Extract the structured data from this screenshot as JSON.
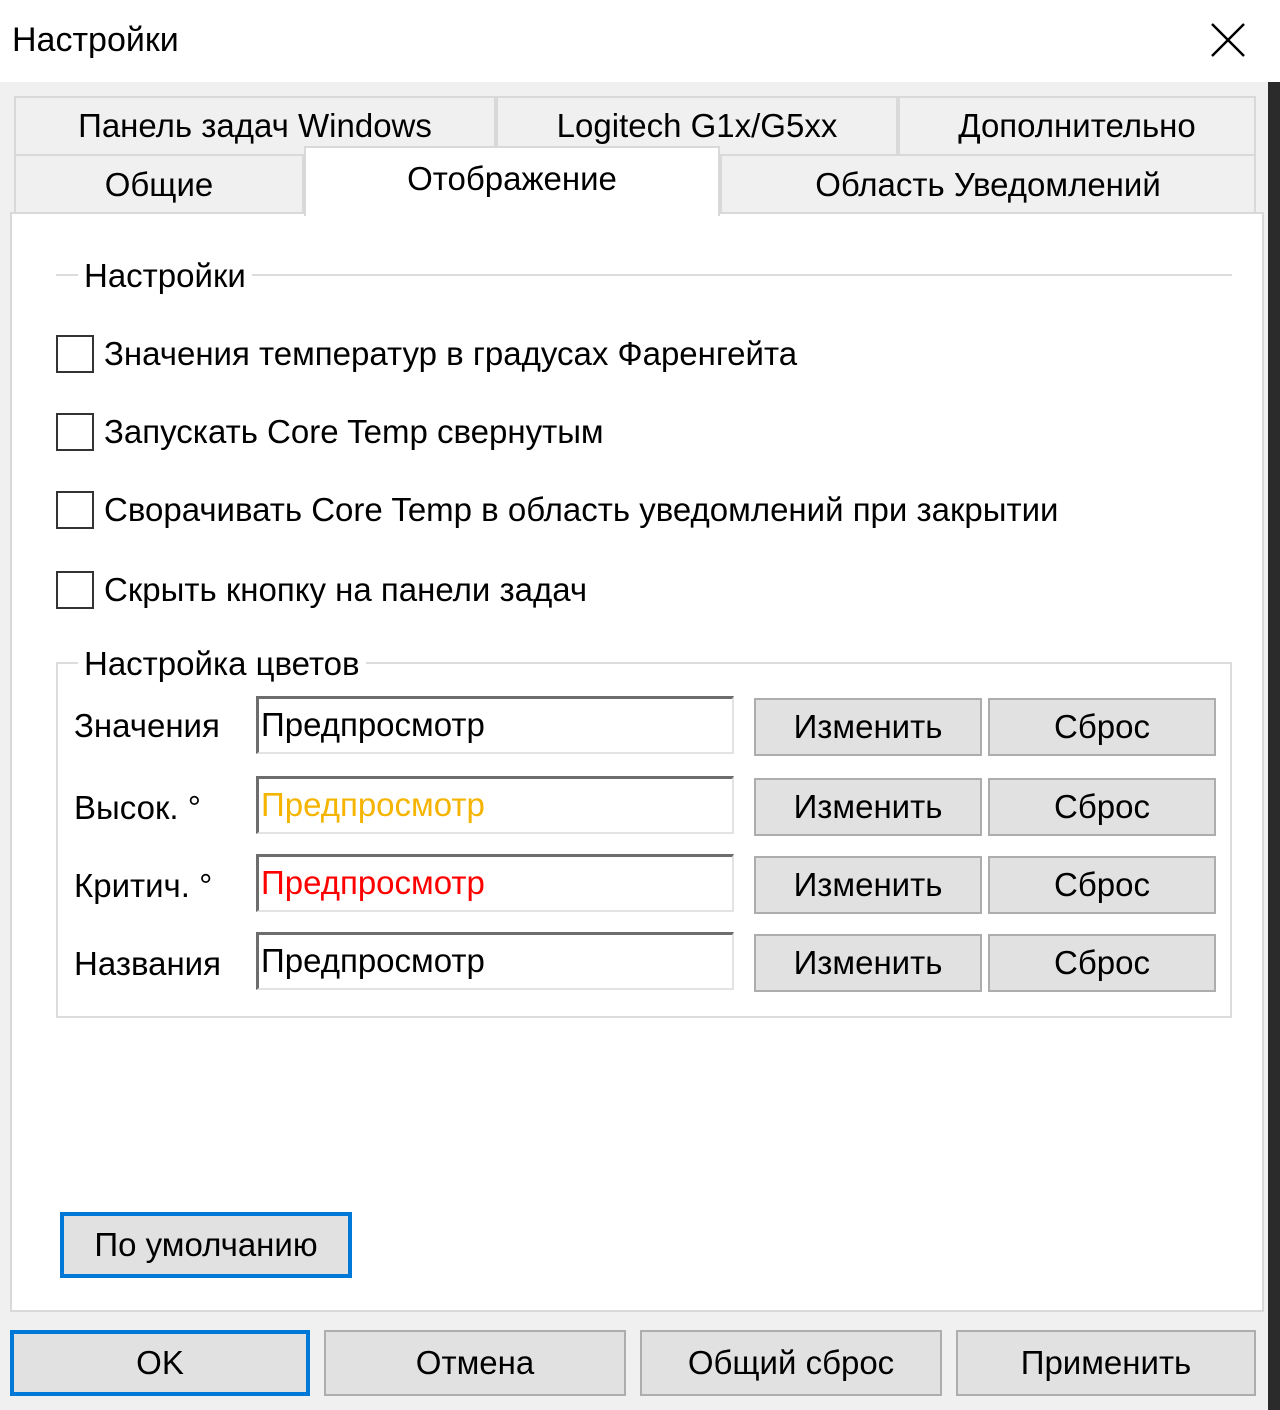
{
  "window": {
    "title": "Настройки",
    "close_icon": "close-icon"
  },
  "tabs": {
    "row_top": [
      {
        "label": "Панель задач Windows"
      },
      {
        "label": "Logitech G1x/G5xx"
      },
      {
        "label": "Дополнительно"
      }
    ],
    "row_bottom": [
      {
        "label": "Общие"
      },
      {
        "label": "Отображение",
        "active": true
      },
      {
        "label": "Область Уведомлений"
      }
    ]
  },
  "settings_group": {
    "legend": "Настройки",
    "checkboxes": [
      {
        "label": "Значения температур в градусах Фаренгейта",
        "checked": false
      },
      {
        "label": "Запускать Core Temp свернутым",
        "checked": false
      },
      {
        "label": "Сворачивать Core Temp в область уведомлений при закрытии",
        "checked": false
      },
      {
        "label": "Скрыть кнопку на панели задач",
        "checked": false
      }
    ]
  },
  "color_group": {
    "legend": "Настройка цветов",
    "rows": [
      {
        "label": "Значения",
        "preview": "Предпросмотр",
        "color": "#000000",
        "change": "Изменить",
        "reset": "Сброс"
      },
      {
        "label": "Высок. °",
        "preview": "Предпросмотр",
        "color": "#f5b400",
        "change": "Изменить",
        "reset": "Сброс"
      },
      {
        "label": "Критич. °",
        "preview": "Предпросмотр",
        "color": "#ff0000",
        "change": "Изменить",
        "reset": "Сброс"
      },
      {
        "label": "Названия",
        "preview": "Предпросмотр",
        "color": "#000000",
        "change": "Изменить",
        "reset": "Сброс"
      }
    ]
  },
  "default_button": "По умолчанию",
  "footer": {
    "ok": "OK",
    "cancel": "Отмена",
    "reset_all": "Общий сброс",
    "apply": "Применить"
  },
  "colors": {
    "focus_border": "#0078d7"
  }
}
